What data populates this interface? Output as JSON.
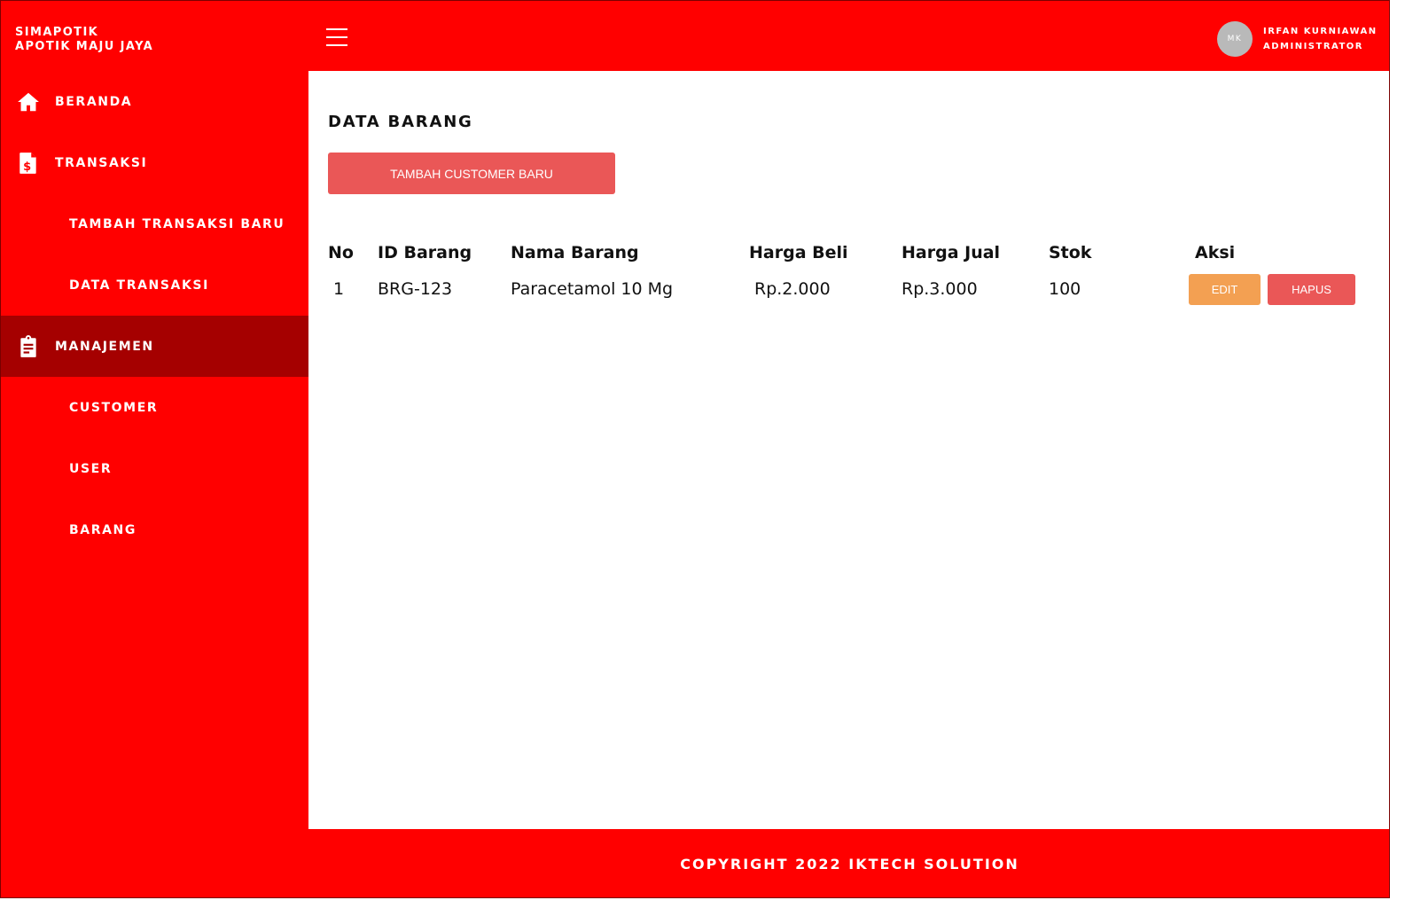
{
  "brand": {
    "line1": "SIMAPOTIK",
    "line2": "APOTIK MAJU JAYA"
  },
  "header": {
    "avatar_initials": "MK",
    "user_name": "IRFAN KURNIAWAN",
    "user_role": "ADMINISTRATOR"
  },
  "sidebar": {
    "items": [
      {
        "label": "BERANDA",
        "icon": "home-icon",
        "level": "top",
        "active": false
      },
      {
        "label": "TRANSAKSI",
        "icon": "invoice-dollar-icon",
        "level": "top",
        "active": false
      },
      {
        "label": "TAMBAH TRANSAKSI BARU",
        "level": "sub",
        "active": false
      },
      {
        "label": "DATA TRANSAKSI",
        "level": "sub",
        "active": false
      },
      {
        "label": "MANAJEMEN",
        "icon": "clipboard-icon",
        "level": "top",
        "active": true
      },
      {
        "label": "CUSTOMER",
        "level": "sub",
        "active": false
      },
      {
        "label": "USER",
        "level": "sub",
        "active": false
      },
      {
        "label": "BARANG",
        "level": "sub",
        "active": false
      }
    ]
  },
  "main": {
    "title": "DATA BARANG",
    "add_button": "TAMBAH CUSTOMER BARU",
    "table": {
      "headers": [
        "No",
        "ID Barang",
        "Nama Barang",
        "Harga Beli",
        "Harga Jual",
        "Stok",
        "Aksi"
      ],
      "rows": [
        {
          "no": "1",
          "id": "BRG-123",
          "nama": "Paracetamol 10 Mg",
          "harga_beli": "Rp.2.000",
          "harga_jual": "Rp.3.000",
          "stok": "100"
        }
      ],
      "edit_label": "EDIT",
      "delete_label": "HAPUS"
    }
  },
  "footer": {
    "text": "COPYRIGHT 2022 IKTECH SOLUTION"
  },
  "colors": {
    "primary": "#ff0000",
    "sidebar_active": "#a50000",
    "button_red": "#ea5757",
    "button_orange": "#f3a052",
    "avatar_bg": "#b9b9b9"
  }
}
